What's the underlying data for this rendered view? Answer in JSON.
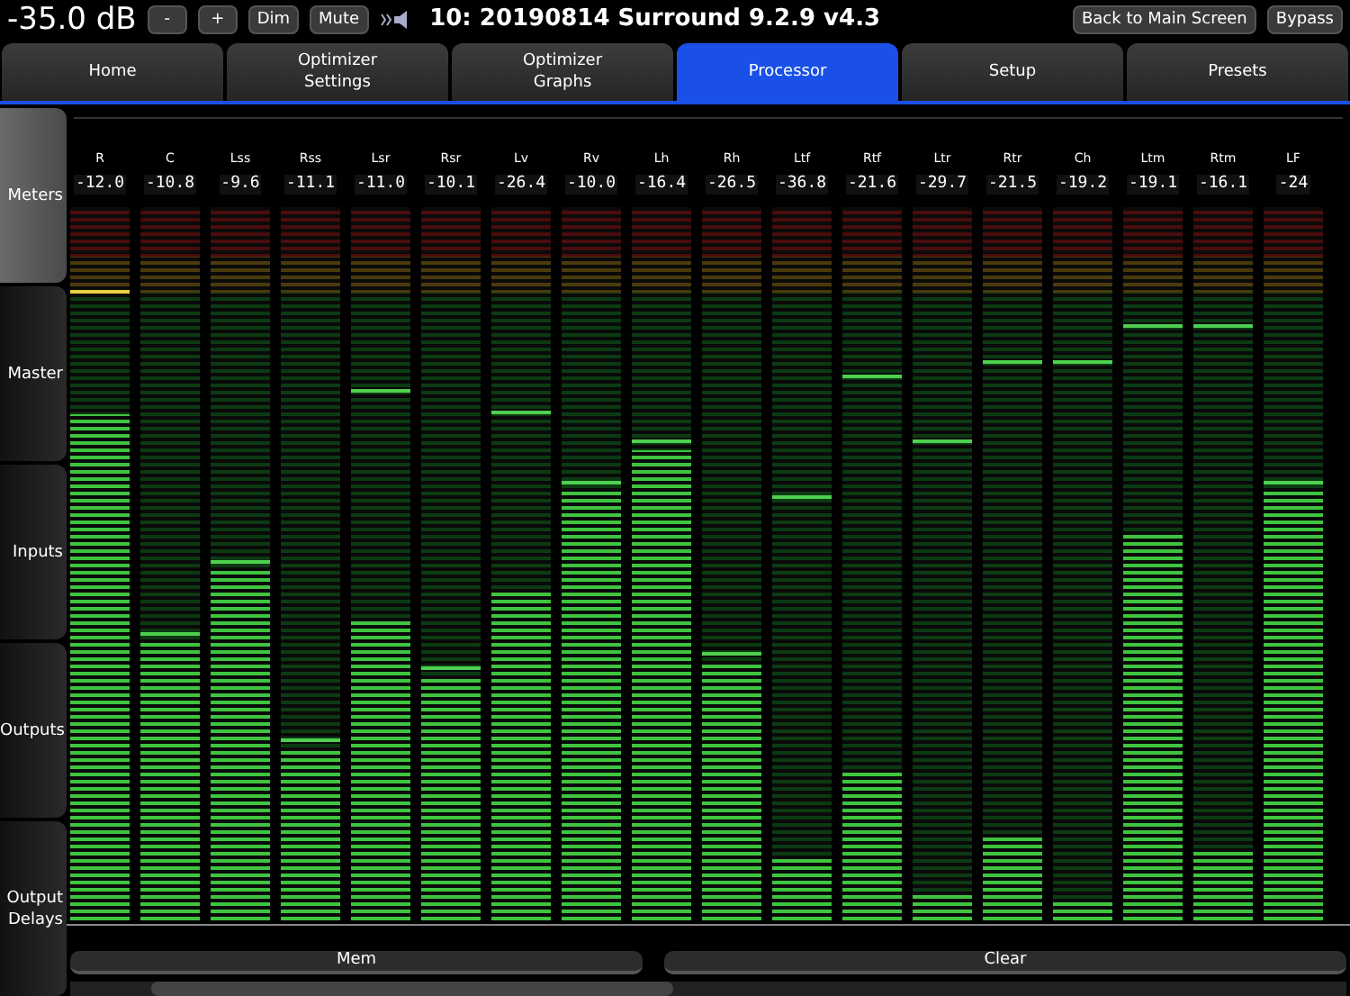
{
  "header": {
    "volume": "-35.0 dB",
    "buttons": [
      {
        "label": "-"
      },
      {
        "label": "+"
      },
      {
        "label": "Dim"
      },
      {
        "label": "Mute"
      }
    ],
    "title": "10: 20190814 Surround 9.2.9 v4.3",
    "right_buttons": [
      {
        "label": "Back to Main Screen"
      },
      {
        "label": "Bypass"
      }
    ]
  },
  "tabs": [
    {
      "label": "Home",
      "selected": false
    },
    {
      "label": "Optimizer\nSettings",
      "selected": false
    },
    {
      "label": "Optimizer\nGraphs",
      "selected": false
    },
    {
      "label": "Processor",
      "selected": true
    },
    {
      "label": "Setup",
      "selected": false
    },
    {
      "label": "Presets",
      "selected": false
    }
  ],
  "sidebar": [
    {
      "label": "Meters",
      "selected": true
    },
    {
      "label": "Master",
      "selected": false
    },
    {
      "label": "Inputs",
      "selected": false
    },
    {
      "label": "Outputs",
      "selected": false
    },
    {
      "label": "Output\nDelays",
      "selected": false
    }
  ],
  "channels": [
    {
      "name": "R",
      "reading": "-12.0",
      "level": 0.71,
      "peak": {
        "level": 0.88
      }
    },
    {
      "name": "C",
      "reading": "-10.8",
      "level": 0.39,
      "peak": {
        "level": 0.4
      }
    },
    {
      "name": "Lss",
      "reading": "-9.6",
      "level": 0.49,
      "peak": {
        "level": 0.5
      }
    },
    {
      "name": "Rss",
      "reading": "-11.1",
      "level": 0.24,
      "peak": {
        "level": 0.25
      }
    },
    {
      "name": "Lsr",
      "reading": "-11.0",
      "level": 0.42,
      "peak": {
        "level": 0.74
      }
    },
    {
      "name": "Rsr",
      "reading": "-10.1",
      "level": 0.34,
      "peak": {
        "level": 0.35
      }
    },
    {
      "name": "Lv",
      "reading": "-26.4",
      "level": 0.46,
      "peak": {
        "level": 0.71
      }
    },
    {
      "name": "Rv",
      "reading": "-10.0",
      "level": 0.6,
      "peak": {
        "level": 0.61
      }
    },
    {
      "name": "Lh",
      "reading": "-16.4",
      "level": 0.66,
      "peak": {
        "level": 0.67
      }
    },
    {
      "name": "Rh",
      "reading": "-26.5",
      "level": 0.36,
      "peak": {
        "level": 0.37
      }
    },
    {
      "name": "Ltf",
      "reading": "-36.8",
      "level": 0.09,
      "peak": {
        "level": 0.59
      }
    },
    {
      "name": "Rtf",
      "reading": "-21.6",
      "level": 0.21,
      "peak": {
        "level": 0.76
      }
    },
    {
      "name": "Ltr",
      "reading": "-29.7",
      "level": 0.04,
      "peak": {
        "level": 0.67
      }
    },
    {
      "name": "Rtr",
      "reading": "-21.5",
      "level": 0.12,
      "peak": {
        "level": 0.78
      }
    },
    {
      "name": "Ch",
      "reading": "-19.2",
      "level": 0.03,
      "peak": {
        "level": 0.78
      }
    },
    {
      "name": "Ltm",
      "reading": "-19.1",
      "level": 0.54,
      "peak": {
        "level": 0.83
      }
    },
    {
      "name": "Rtm",
      "reading": "-16.1",
      "level": 0.1,
      "peak": {
        "level": 0.83
      }
    },
    {
      "name": "LF",
      "reading": "-24",
      "level": 0.6,
      "peak": {
        "level": 0.61
      }
    }
  ],
  "bottom_buttons": [
    {
      "label": "Mem"
    },
    {
      "label": "Clear"
    }
  ]
}
